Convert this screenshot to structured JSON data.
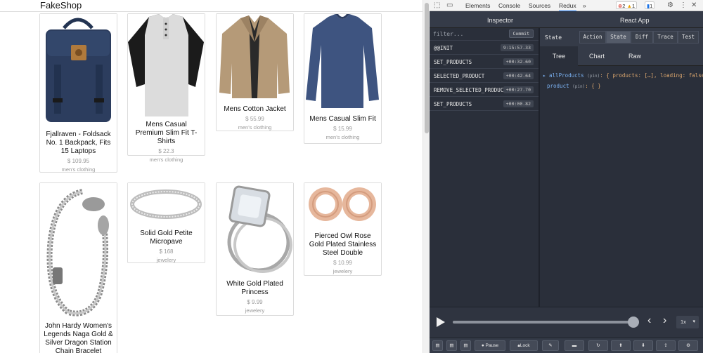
{
  "shop": {
    "title": "FakeShop",
    "products": [
      {
        "title": "Fjallraven - Foldsack No. 1 Backpack, Fits 15 Laptops",
        "price": "$ 109.95",
        "category": "men's clothing"
      },
      {
        "title": "Mens Casual Premium Slim Fit T-Shirts",
        "price": "$ 22.3",
        "category": "men's clothing"
      },
      {
        "title": "Mens Cotton Jacket",
        "price": "$ 55.99",
        "category": "men's clothing"
      },
      {
        "title": "Mens Casual Slim Fit",
        "price": "$ 15.99",
        "category": "men's clothing"
      },
      {
        "title": "John Hardy Women's Legends Naga Gold & Silver Dragon Station Chain Bracelet",
        "price": "",
        "category": ""
      },
      {
        "title": "Solid Gold Petite Micropave",
        "price": "$ 168",
        "category": "jewelery"
      },
      {
        "title": "White Gold Plated Princess",
        "price": "$ 9.99",
        "category": "jewelery"
      },
      {
        "title": "Pierced Owl Rose Gold Plated Stainless Steel Double",
        "price": "$ 10.99",
        "category": "jewelery"
      }
    ]
  },
  "devtools": {
    "tabs": [
      "Elements",
      "Console",
      "Sources",
      "Redux"
    ],
    "active_tab": "Redux",
    "more": "»",
    "badges": {
      "errors": "2",
      "warnings": "1",
      "messages": "1"
    },
    "icons": [
      "inspect-icon",
      "device-icon",
      "gear-icon",
      "more-vert-icon",
      "close-icon"
    ]
  },
  "redux": {
    "inspector_label": "Inspector",
    "app_name": "React App",
    "filter_placeholder": "filter...",
    "commit_label": "Commit",
    "actions": [
      {
        "name": "@@INIT",
        "time": "9:15:57.33"
      },
      {
        "name": "SET_PRODUCTS",
        "time": "+00:32.60"
      },
      {
        "name": "SELECTED_PRODUCT",
        "time": "+00:42.64"
      },
      {
        "name": "REMOVE_SELECTED_PRODUCT",
        "time": "+00:27.70"
      },
      {
        "name": "SET_PRODUCTS",
        "time": "+00:00.82"
      }
    ],
    "state_label": "State",
    "view_buttons": [
      "Action",
      "State",
      "Diff",
      "Trace",
      "Test"
    ],
    "active_view": "State",
    "state_tabs": [
      "Tree",
      "Chart",
      "Raw"
    ],
    "active_state_tab": "Tree",
    "tree": [
      {
        "arrow": "▸",
        "key": "allProducts",
        "pin": "(pin)",
        "value": ": { products: […], loading: false }"
      },
      {
        "arrow": "",
        "key": "product",
        "pin": "(pin)",
        "value": ": { }"
      }
    ],
    "slider": {
      "position": 1.0,
      "prev": "‹",
      "next": "›",
      "speed": "1x"
    },
    "bottom_buttons": [
      "Pause",
      "Lock"
    ]
  }
}
